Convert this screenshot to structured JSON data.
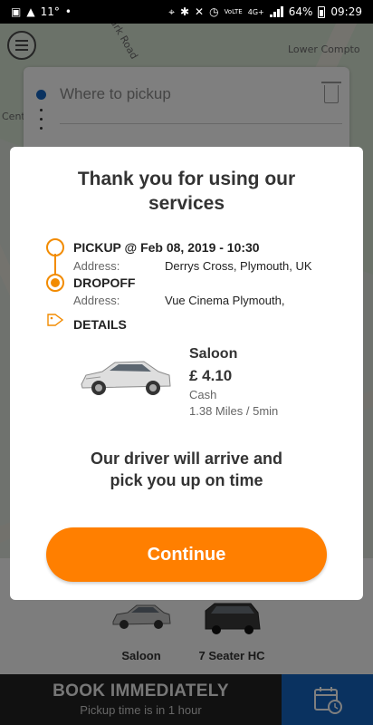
{
  "status_bar": {
    "temperature": "11°",
    "network": "4G+",
    "volte": "VoLTE",
    "battery": "64%",
    "time": "09:29"
  },
  "map": {
    "label_top_right": "Lower Compto",
    "label_road": "Park Road",
    "label_left": "Cent"
  },
  "pickup_card": {
    "placeholder": "Where to pickup"
  },
  "dialog": {
    "title": "Thank you for using our services",
    "pickup": {
      "heading": "PICKUP @ Feb 08, 2019 - 10:30",
      "address_label": "Address:",
      "address": "Derrys Cross, Plymouth, UK"
    },
    "dropoff": {
      "heading": "DROPOFF",
      "address_label": "Address:",
      "address": "Vue Cinema Plymouth,"
    },
    "details_heading": "DETAILS",
    "vehicle": {
      "name": "Saloon",
      "price": "£ 4.10",
      "payment": "Cash",
      "distance": "1.38 Miles / 5min"
    },
    "message": "Our driver will arrive and pick you up on time",
    "continue_label": "Continue"
  },
  "vehicles": [
    {
      "label": "Saloon"
    },
    {
      "label": "7 Seater HC"
    }
  ],
  "bottom_bar": {
    "book_label": "BOOK IMMEDIATELY",
    "book_sub": "Pickup time is in 1 hour"
  },
  "colors": {
    "accent": "#ff7f00",
    "route": "#f28b00",
    "schedule_blue": "#1565c0",
    "book_bar": "#222222"
  }
}
